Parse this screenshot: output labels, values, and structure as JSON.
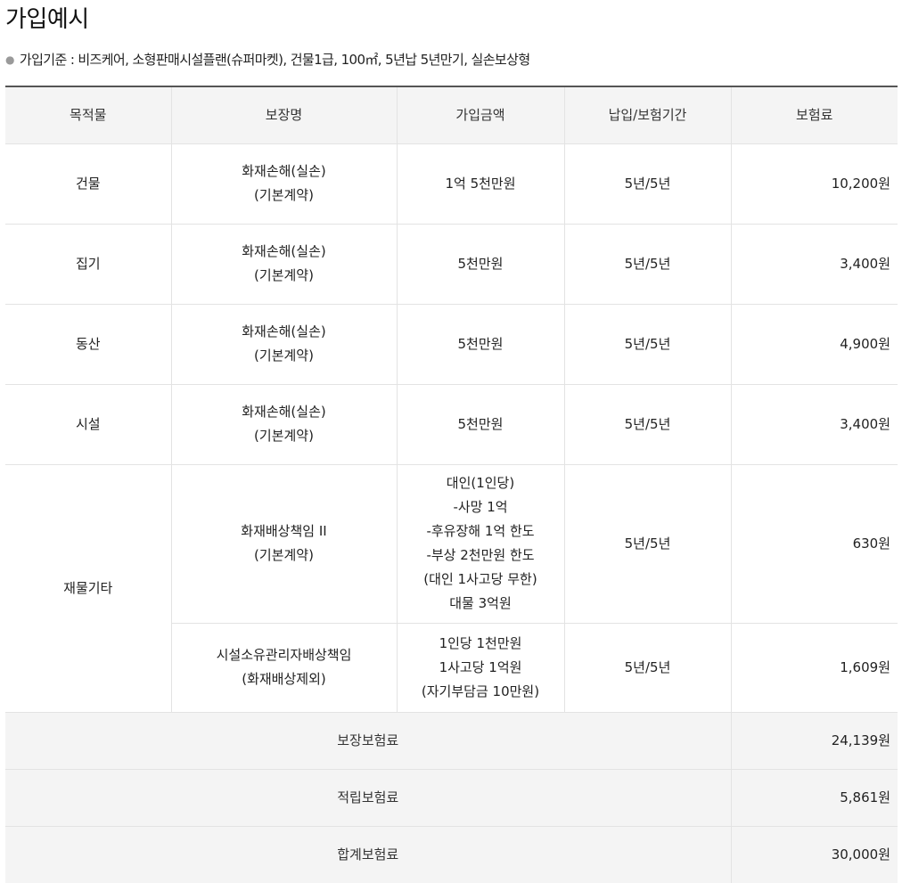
{
  "title": "가입예시",
  "basis": {
    "label": "가입기준 :",
    "text": "비즈케어, 소형판매시설플랜(슈퍼마켓), 건물1급, 100㎡, 5년납 5년만기, 실손보상형"
  },
  "table": {
    "headers": [
      "목적물",
      "보장명",
      "가입금액",
      "납입/보험기간",
      "보험료"
    ],
    "rows": [
      {
        "target": "건물",
        "coverage": [
          "화재손해(실손)",
          "(기본계약)"
        ],
        "amount": [
          "1억 5천만원"
        ],
        "period": "5년/5년",
        "premium": "10,200원"
      },
      {
        "target": "집기",
        "coverage": [
          "화재손해(실손)",
          "(기본계약)"
        ],
        "amount": [
          "5천만원"
        ],
        "period": "5년/5년",
        "premium": "3,400원"
      },
      {
        "target": "동산",
        "coverage": [
          "화재손해(실손)",
          "(기본계약)"
        ],
        "amount": [
          "5천만원"
        ],
        "period": "5년/5년",
        "premium": "4,900원"
      },
      {
        "target": "시설",
        "coverage": [
          "화재손해(실손)",
          "(기본계약)"
        ],
        "amount": [
          "5천만원"
        ],
        "period": "5년/5년",
        "premium": "3,400원"
      }
    ],
    "other": {
      "target": "재물기타",
      "items": [
        {
          "coverage": [
            "화재배상책임 II",
            "(기본계약)"
          ],
          "amount": [
            "대인(1인당)",
            "-사망 1억",
            "-후유장해 1억 한도",
            "-부상 2천만원 한도",
            "(대인 1사고당 무한)",
            "대물 3억원"
          ],
          "period": "5년/5년",
          "premium": "630원"
        },
        {
          "coverage": [
            "시설소유관리자배상책임",
            "(화재배상제외)"
          ],
          "amount": [
            "1인당 1천만원",
            "1사고당 1억원",
            "(자기부담금 10만원)"
          ],
          "period": "5년/5년",
          "premium": "1,609원"
        }
      ]
    },
    "summary": [
      {
        "label": "보장보험료",
        "value": "24,139원"
      },
      {
        "label": "적립보험료",
        "value": "5,861원"
      },
      {
        "label": "합계보험료",
        "value": "30,000원"
      }
    ]
  }
}
